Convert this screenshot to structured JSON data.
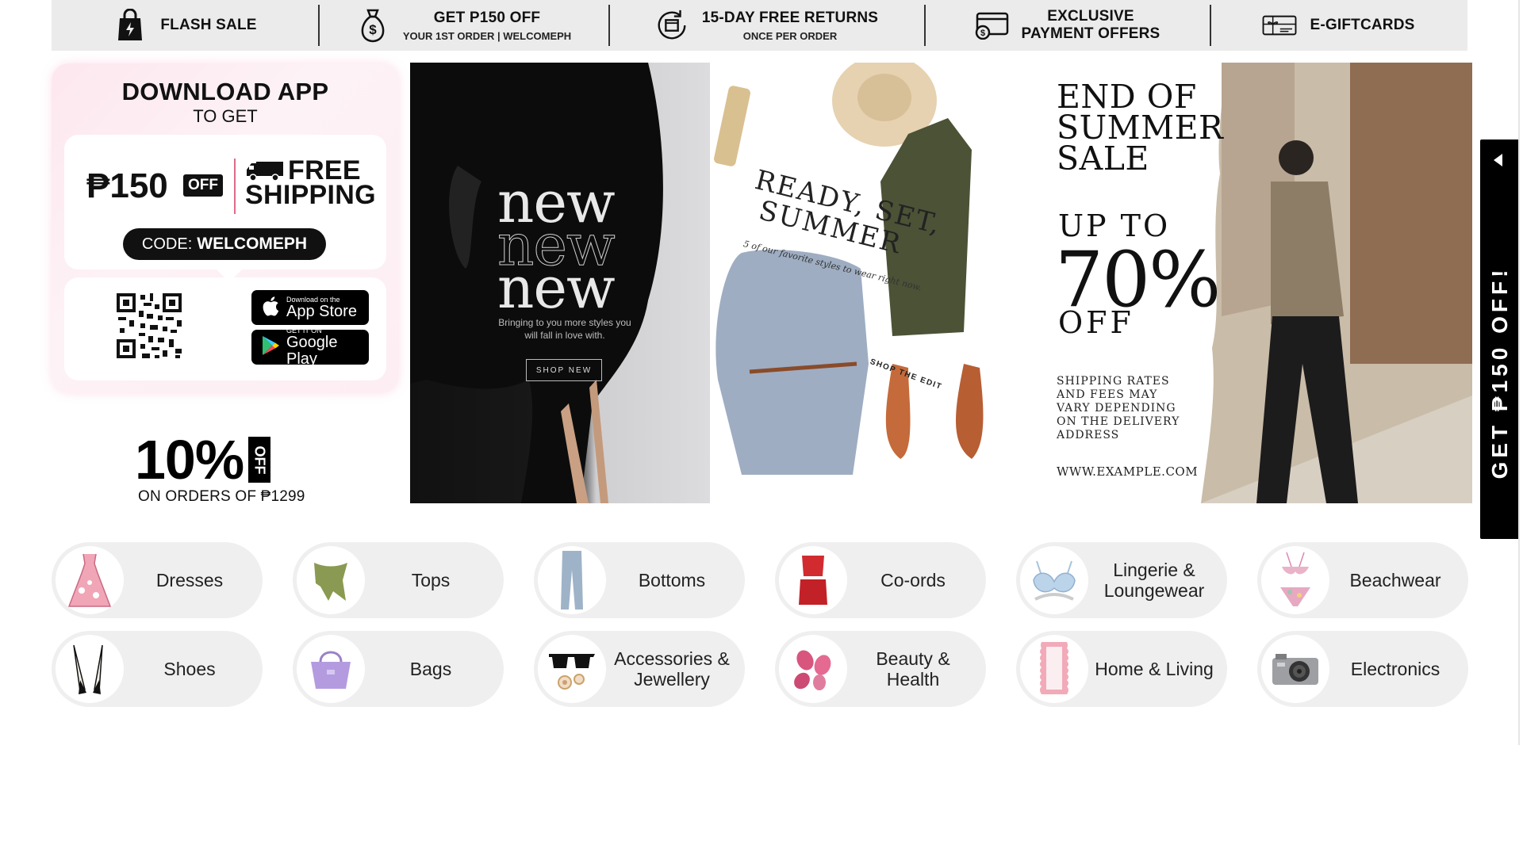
{
  "promo_strip": [
    {
      "icon": "shopping-bag-icon",
      "title": "FLASH SALE",
      "subtitle": ""
    },
    {
      "icon": "money-bag-icon",
      "title": "GET P150 OFF",
      "subtitle": "YOUR 1ST ORDER | WELCOMEPH"
    },
    {
      "icon": "return-box-icon",
      "title": "15-DAY FREE RETURNS",
      "subtitle": "ONCE PER ORDER"
    },
    {
      "icon": "payment-card-icon",
      "title_line1": "EXCLUSIVE",
      "title_line2": "PAYMENT OFFERS"
    },
    {
      "icon": "gift-card-icon",
      "title": "E-GIFTCARDS"
    }
  ],
  "app_card": {
    "heading": "DOWNLOAD APP",
    "subheading": "TO GET",
    "amount": "₱150",
    "off_tag": "OFF",
    "free_line1": "FREE",
    "free_line2": "SHIPPING",
    "code_label": "CODE:",
    "code_value": "WELCOMEPH",
    "app_store_small": "Download on the",
    "app_store_big": "App Store",
    "google_small": "GET IT ON",
    "google_big": "Google Play"
  },
  "ten_off": {
    "value": "10%",
    "tag": "OFF",
    "subtext": "ON ORDERS OF ₱1299"
  },
  "banner_new": {
    "word": "new",
    "tagline": "Bringing to you more styles you will fall in love with.",
    "button": "SHOP NEW"
  },
  "banner_summer": {
    "headline_1": "READY, SET,",
    "headline_2": "SUMMER",
    "subline": "5 of our favorite styles to wear right now.",
    "cta": "SHOP THE EDIT"
  },
  "banner_sale": {
    "title_1": "END OF",
    "title_2": "SUMMER",
    "title_3": "SALE",
    "upto": "UP TO",
    "percent": "70%",
    "off": "OFF",
    "note": "SHIPPING RATES AND FEES MAY VARY DEPENDING ON THE DELIVERY ADDRESS",
    "url": "WWW.EXAMPLE.COM"
  },
  "side_tab": {
    "text": "GET ₱150 OFF!"
  },
  "categories": [
    {
      "label": "Dresses",
      "icon": "dress-icon"
    },
    {
      "label": "Tops",
      "icon": "top-icon"
    },
    {
      "label": "Bottoms",
      "icon": "jeans-icon"
    },
    {
      "label": "Co-ords",
      "icon": "coord-set-icon"
    },
    {
      "label": "Lingerie & Loungewear",
      "icon": "bra-icon"
    },
    {
      "label": "Beachwear",
      "icon": "bikini-icon"
    },
    {
      "label": "Shoes",
      "icon": "heels-icon"
    },
    {
      "label": "Bags",
      "icon": "handbag-icon"
    },
    {
      "label": "Accessories & Jewellery",
      "icon": "sunglasses-icon"
    },
    {
      "label": "Beauty & Health",
      "icon": "makeup-sponge-icon"
    },
    {
      "label": "Home & Living",
      "icon": "mirror-icon"
    },
    {
      "label": "Electronics",
      "icon": "camera-icon"
    }
  ]
}
